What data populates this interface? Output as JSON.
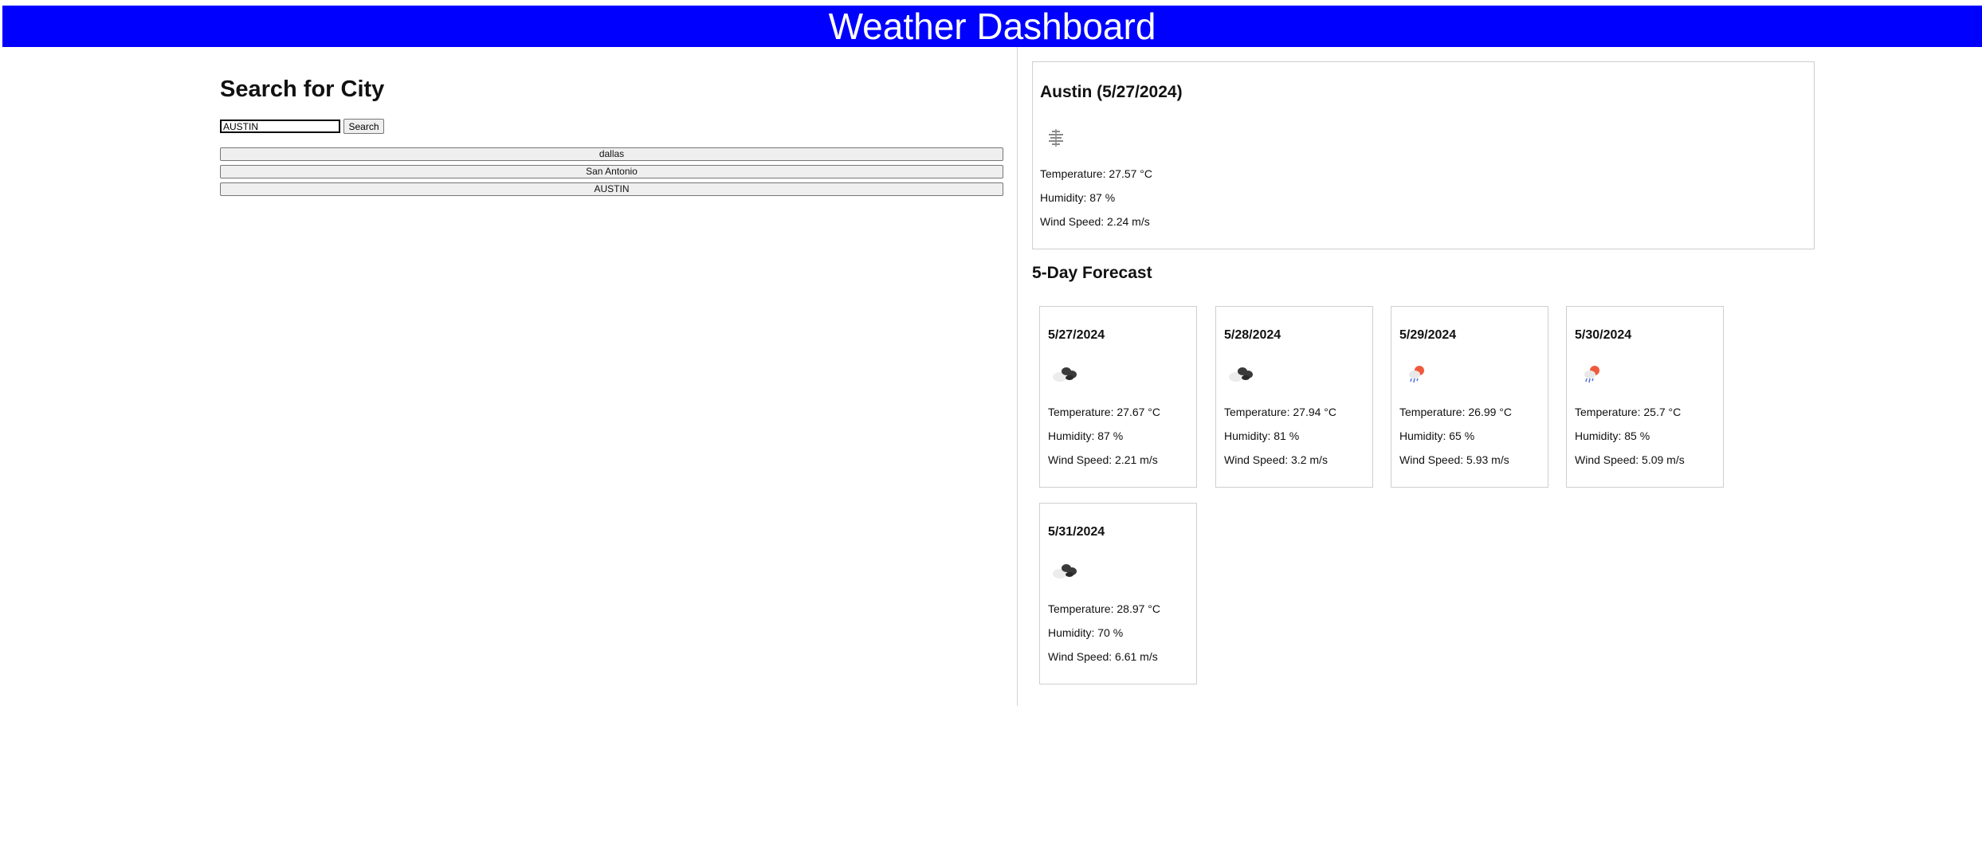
{
  "header": {
    "title": "Weather Dashboard"
  },
  "search": {
    "title": "Search for City",
    "input_value": "AUSTIN",
    "button_label": "Search",
    "history": [
      "dallas",
      "San Antonio",
      "AUSTIN"
    ]
  },
  "current": {
    "title": "Austin (5/27/2024)",
    "icon": "mist-icon",
    "temperature": "Temperature: 27.57 °C",
    "humidity": "Humidity: 87 %",
    "wind": "Wind Speed: 2.24 m/s"
  },
  "forecast": {
    "title": "5-Day Forecast",
    "days": [
      {
        "date": "5/27/2024",
        "icon": "broken-clouds-icon",
        "temperature": "Temperature: 27.67 °C",
        "humidity": "Humidity: 87 %",
        "wind": "Wind Speed: 2.21 m/s"
      },
      {
        "date": "5/28/2024",
        "icon": "broken-clouds-icon",
        "temperature": "Temperature: 27.94 °C",
        "humidity": "Humidity: 81 %",
        "wind": "Wind Speed: 3.2 m/s"
      },
      {
        "date": "5/29/2024",
        "icon": "sun-rain-icon",
        "temperature": "Temperature: 26.99 °C",
        "humidity": "Humidity: 65 %",
        "wind": "Wind Speed: 5.93 m/s"
      },
      {
        "date": "5/30/2024",
        "icon": "sun-rain-icon",
        "temperature": "Temperature: 25.7 °C",
        "humidity": "Humidity: 85 %",
        "wind": "Wind Speed: 5.09 m/s"
      },
      {
        "date": "5/31/2024",
        "icon": "broken-clouds-icon",
        "temperature": "Temperature: 28.97 °C",
        "humidity": "Humidity: 70 %",
        "wind": "Wind Speed: 6.61 m/s"
      }
    ]
  },
  "colors": {
    "header_bg": "#0000ff",
    "header_text": "#ffffff",
    "card_border": "#cfcfcf"
  }
}
